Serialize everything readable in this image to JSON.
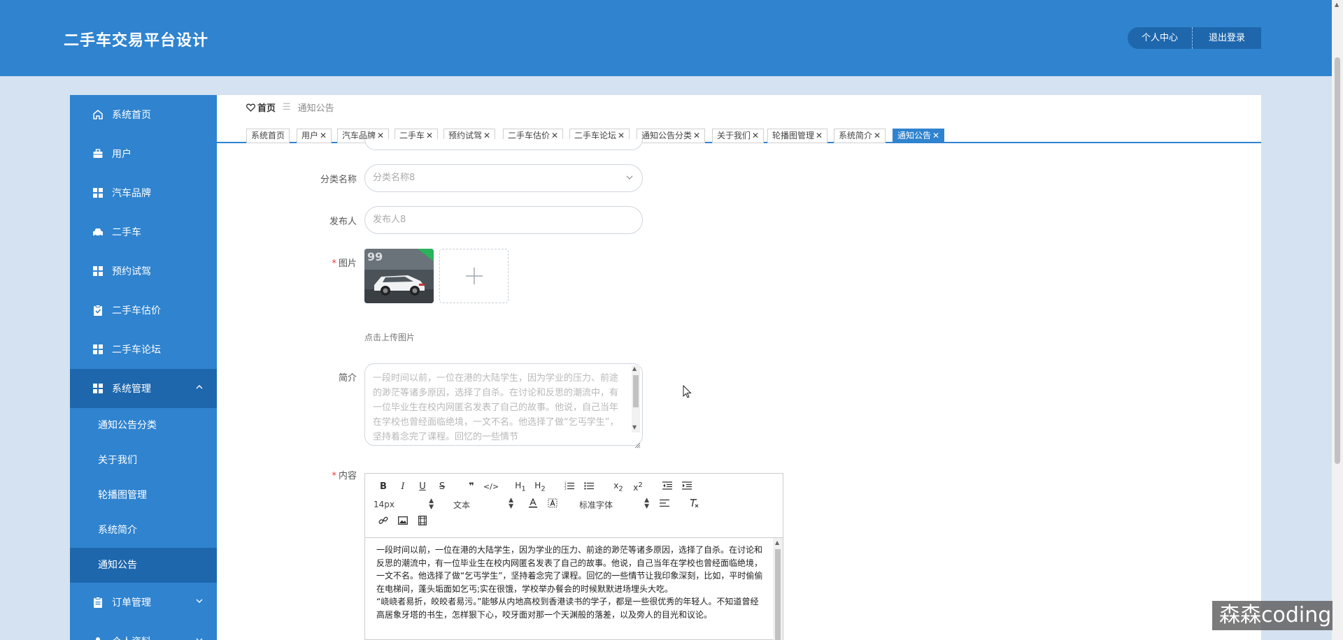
{
  "header": {
    "title": "二手车交易平台设计",
    "personal_center": "个人中心",
    "logout": "退出登录"
  },
  "sidebar": {
    "items": [
      {
        "label": "系统首页",
        "icon": "home-icon"
      },
      {
        "label": "用户",
        "icon": "briefcase-icon"
      },
      {
        "label": "汽车品牌",
        "icon": "grid-icon"
      },
      {
        "label": "二手车",
        "icon": "car-icon"
      },
      {
        "label": "预约试驾",
        "icon": "grid-icon"
      },
      {
        "label": "二手车估价",
        "icon": "clipboard-icon"
      },
      {
        "label": "二手车论坛",
        "icon": "grid-icon"
      }
    ],
    "group_system": {
      "label": "系统管理",
      "icon": "grid-icon"
    },
    "sub_items": [
      "通知公告分类",
      "关于我们",
      "轮播图管理",
      "系统简介",
      "通知公告"
    ],
    "group_orders": {
      "label": "订单管理",
      "icon": "clipboard-icon"
    },
    "group_personal": {
      "label": "个人资料",
      "icon": "person-icon"
    }
  },
  "breadcrumb": {
    "home": "首页",
    "separator": "☰",
    "current": "通知公告"
  },
  "tabs": [
    {
      "label": "系统首页",
      "closable": false
    },
    {
      "label": "用户",
      "closable": true
    },
    {
      "label": "汽车品牌",
      "closable": true
    },
    {
      "label": "二手车",
      "closable": true
    },
    {
      "label": "预约试驾",
      "closable": true
    },
    {
      "label": "二手车估价",
      "closable": true
    },
    {
      "label": "二手车论坛",
      "closable": true
    },
    {
      "label": "通知公告分类",
      "closable": true
    },
    {
      "label": "关于我们",
      "closable": true
    },
    {
      "label": "轮播图管理",
      "closable": true
    },
    {
      "label": "系统简介",
      "closable": true
    },
    {
      "label": "通知公告",
      "closable": true,
      "active": true
    }
  ],
  "form": {
    "category_label": "分类名称",
    "category_placeholder": "分类名称8",
    "publisher_label": "发布人",
    "publisher_placeholder": "发布人8",
    "image_label": "图片",
    "upload_tip": "点击上传图片",
    "intro_label": "简介",
    "intro_text": "一段时间以前，一位在港的大陆学生，因为学业的压力、前途的渺茫等诸多原因，选择了自杀。在讨论和反思的潮流中，有一位毕业生在校内网匿名发表了自己的故事。他说，自己当年在学校也曾经面临绝境，一文不名。他选择了做“乞丐学生”，坚持着念完了课程。回忆的一些情节",
    "content_label": "内容",
    "content_text_1": "一段时间以前，一位在港的大陆学生，因为学业的压力、前途的渺茫等诸多原因，选择了自杀。在讨论和反思的潮流中，有一位毕业生在校内网匿名发表了自己的故事。他说，自己当年在学校也曾经面临绝境，一文不名。他选择了做“乞丐学生”，坚持着念完了课程。回忆的一些情节让我印象深刻，比如，平时偷偷在电梯间，蓬头垢面如乞丐;实在很饿，学校举办餐会的时候默默进场埋头大吃。",
    "content_text_2": "“峣峣者易折，皎皎者易污。”能够从内地高校到香港读书的学子，都是一些很优秀的年轻人。不知道曾经高居象牙塔的书生，怎样狠下心，咬牙面对那一个天渊般的落差，以及旁人的目光和议论。"
  },
  "editor": {
    "font_size": "14px",
    "block_type": "文本",
    "font_family": "标准字体"
  },
  "watermark": "森森coding",
  "colors": {
    "primary": "#2f83cf",
    "primary_dark": "#1e67ad",
    "background": "#d4e2f1",
    "required": "#e53935"
  }
}
